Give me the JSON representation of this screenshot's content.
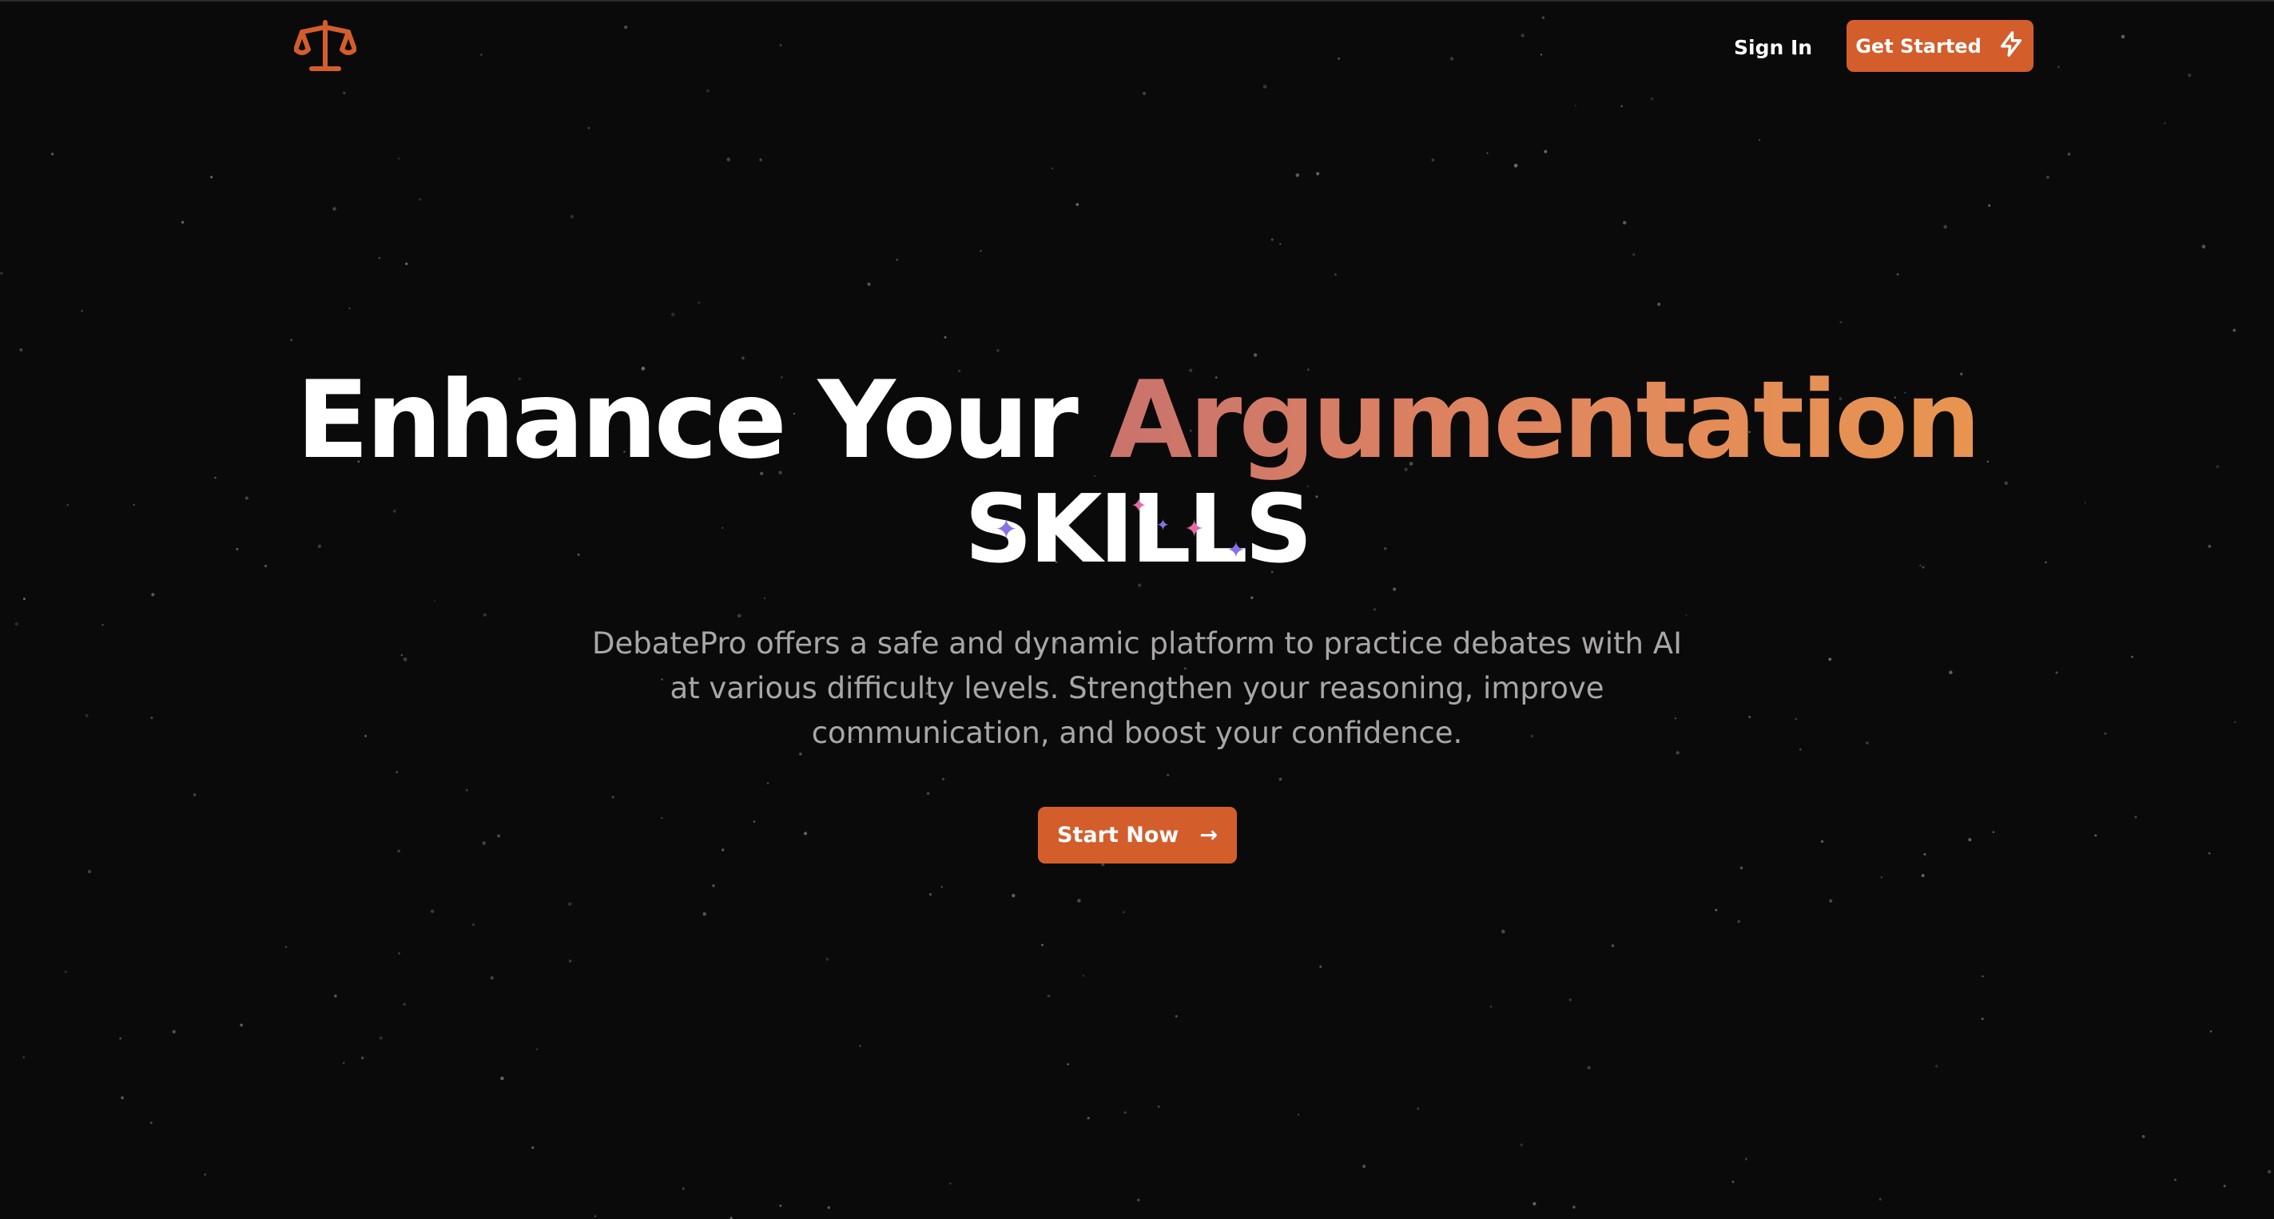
{
  "header": {
    "logo_icon": "scale-balance-icon",
    "sign_in_label": "Sign In",
    "get_started_label": "Get Started",
    "get_started_icon": "lightning-bolt-icon"
  },
  "hero": {
    "headline_plain": "Enhance Your ",
    "headline_highlight": "Argumentation",
    "headline_second_line": "SKILLS",
    "subtitle": "DebatePro offers a safe and dynamic platform to practice debates with AI at various difficulty levels. Strengthen your reasoning, improve communication, and boost your confidence.",
    "cta_label": "Start Now",
    "cta_arrow": "→"
  },
  "colors": {
    "background": "#0b0a0a",
    "accent": "#d35e2c",
    "gradient_start": "#c9736d",
    "gradient_end": "#e89550",
    "subtitle_text": "#a9a7a5",
    "sparkle_purple": "#8b6fe8",
    "sparkle_pink": "#e36aa6"
  }
}
